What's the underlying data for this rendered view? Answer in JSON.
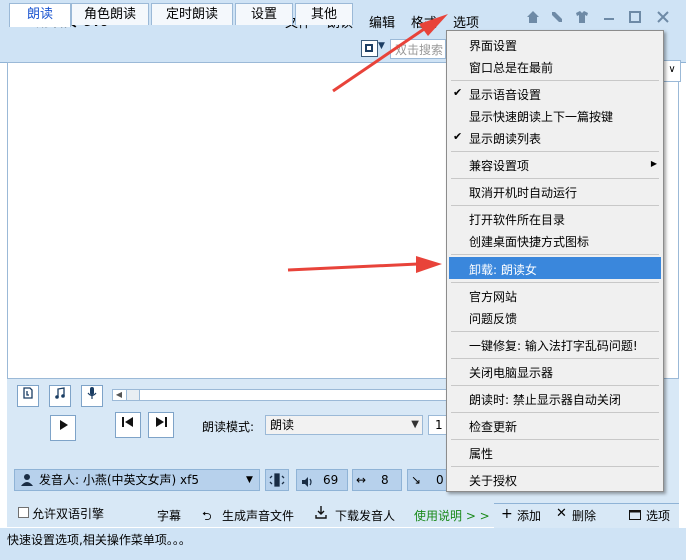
{
  "app": {
    "title": "朗读女 9.0"
  },
  "menubar": [
    "文件",
    "朗读",
    "编辑",
    "格式",
    "选项"
  ],
  "window_buttons": [
    "home-icon",
    "tools-icon",
    "shirt-icon",
    "minimize-icon",
    "maximize-icon",
    "close-icon"
  ],
  "tabs": [
    "朗读",
    "角色朗读",
    "定时朗读",
    "设置",
    "其他"
  ],
  "search": {
    "placeholder": "双击搜索"
  },
  "player": {
    "mode_label": "朗读模式:",
    "mode_value": "朗读",
    "mode_number": "1",
    "voice": "发音人: 小燕(中英文女声) xf5",
    "volume": "69",
    "speed": "8",
    "pitch": "0"
  },
  "bottom": {
    "bilingual": "允许双语引擎",
    "subtitles": "字幕",
    "generate_audio": "生成声音文件",
    "download_voice": "下载发音人",
    "usage": "使用说明 > >",
    "add": "添加",
    "delete": "删除",
    "options": "选项"
  },
  "status": "快速设置选项,相关操作菜单项。。。",
  "dropdown": [
    {
      "label": "界面设置",
      "checked": false
    },
    {
      "label": "窗口总是在最前",
      "checked": false
    },
    {
      "label": "显示语音设置",
      "checked": true
    },
    {
      "label": "显示快速朗读上下一篇按键",
      "checked": false
    },
    {
      "label": "显示朗读列表",
      "checked": true
    },
    {
      "label": "兼容设置项",
      "checked": false,
      "submenu": "▶"
    },
    {
      "label": "取消开机时自动运行",
      "checked": false
    },
    {
      "label": "打开软件所在目录",
      "checked": false
    },
    {
      "label": "创建桌面快捷方式图标",
      "checked": false
    },
    {
      "label": "卸载: 朗读女",
      "checked": false,
      "highlighted": true
    },
    {
      "label": "官方网站",
      "checked": false
    },
    {
      "label": "问题反馈",
      "checked": false
    },
    {
      "label": "一键修复: 输入法打字乱码问题!",
      "checked": false
    },
    {
      "label": "关闭电脑显示器",
      "checked": false
    },
    {
      "label": "朗读时: 禁止显示器自动关闭",
      "checked": false
    },
    {
      "label": "检查更新",
      "checked": false
    },
    {
      "label": "属性",
      "checked": false
    },
    {
      "label": "关于授权",
      "checked": false
    }
  ],
  "colors": {
    "highlight": "#3a87dc",
    "annotation_arrow": "#e8433a",
    "active_tab_text": "#1a54d0",
    "usage_link": "#1a8a1a"
  }
}
